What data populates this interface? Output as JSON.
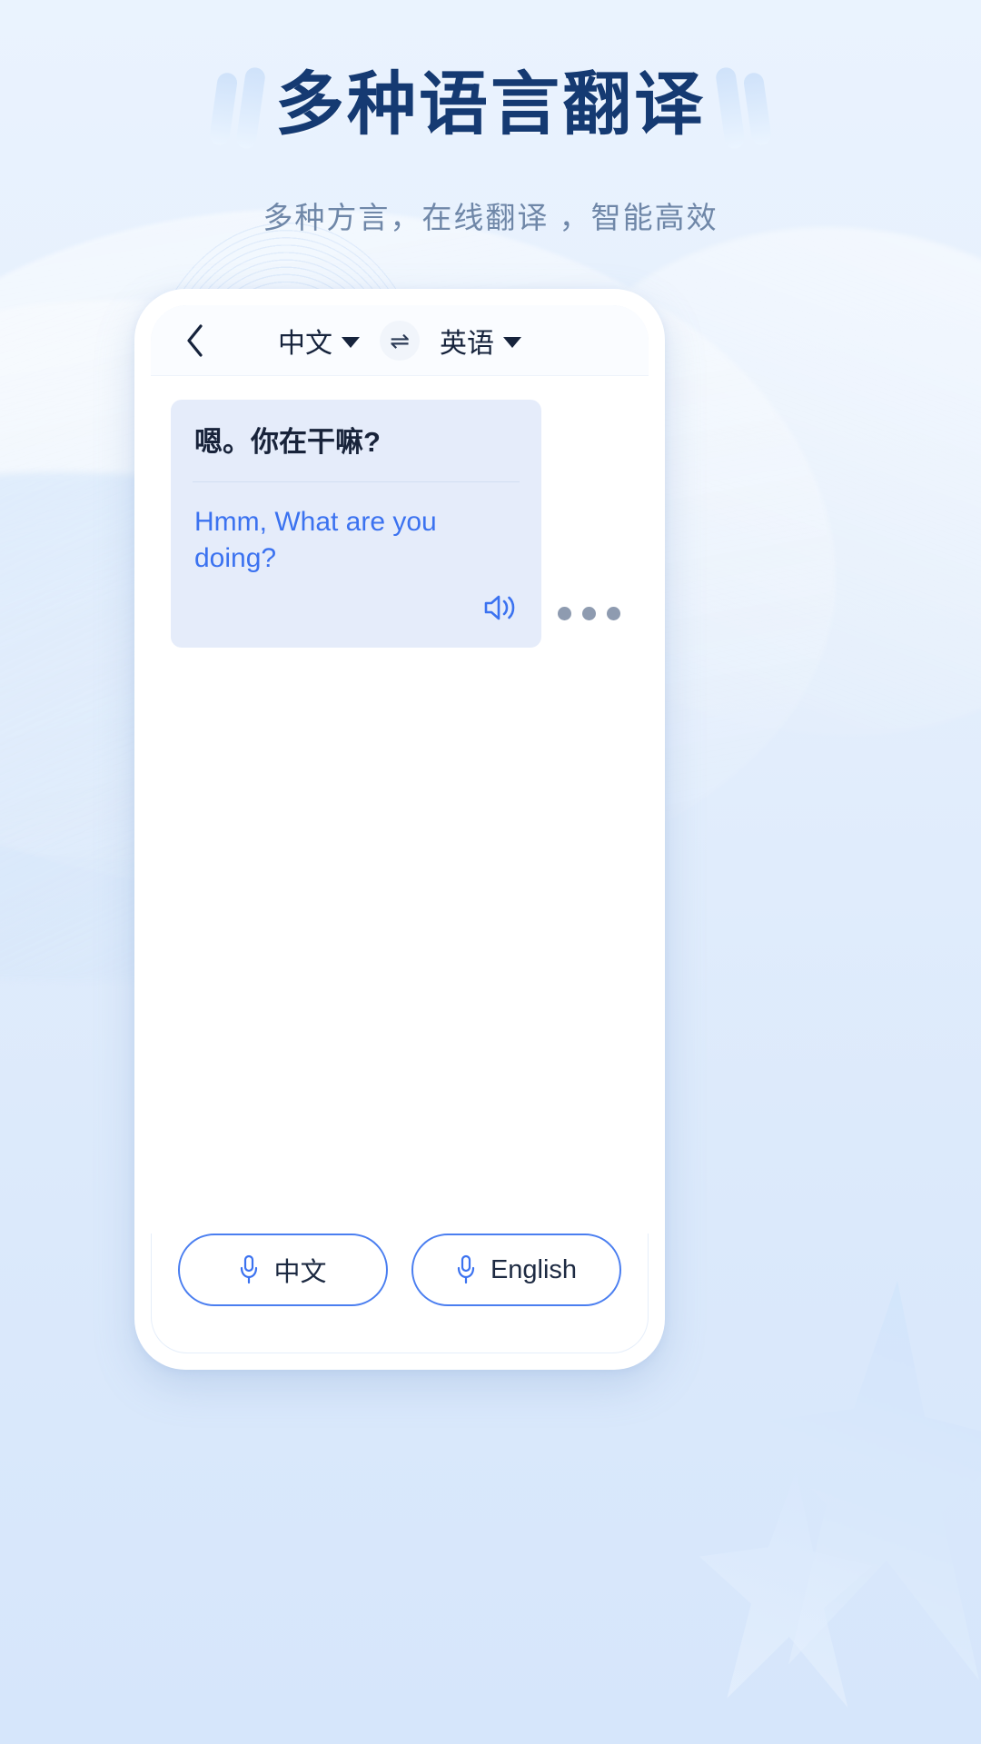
{
  "header": {
    "title": "多种语言翻译",
    "subtitle": "多种方言，在线翻译 ，智能高效"
  },
  "phone": {
    "navbar": {
      "back_icon": "chevron-left-icon",
      "source_language": "中文",
      "swap_icon": "⇌",
      "target_language": "英语"
    },
    "conversation": [
      {
        "source_text": "嗯。你在干嘛?",
        "translated_text": "Hmm, What are you doing?",
        "speaker_icon": "speaker-icon",
        "loading_dots": 3
      }
    ],
    "controls": [
      {
        "icon": "microphone-icon",
        "label": "中文"
      },
      {
        "icon": "microphone-icon",
        "label": "English"
      }
    ]
  },
  "colors": {
    "title": "#153a72",
    "subtitle": "#6f87a8",
    "accent_blue": "#3b72f0",
    "bubble_bg": "#e5ecfa",
    "page_bg": "#e3eefc"
  }
}
